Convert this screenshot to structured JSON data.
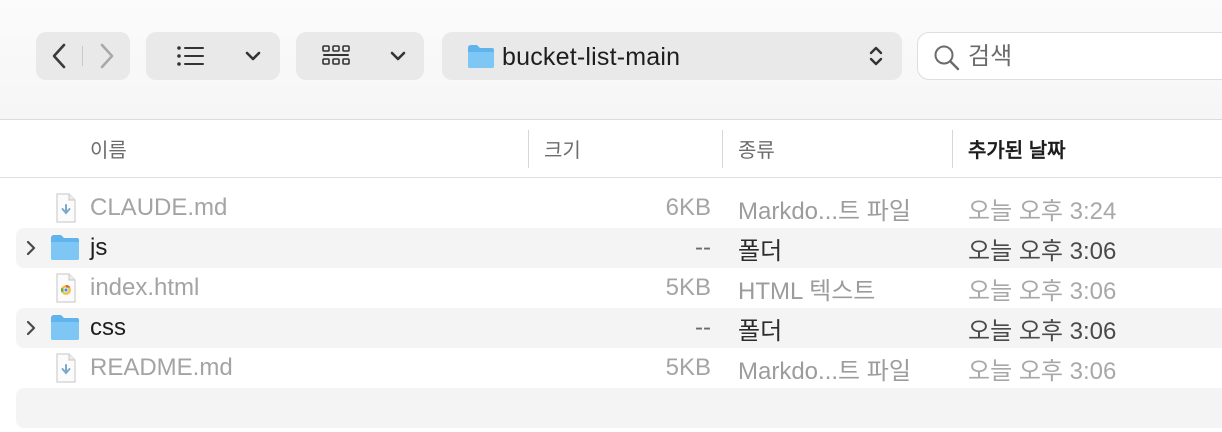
{
  "toolbar": {
    "back_icon": "chevron-left-icon",
    "forward_icon": "chevron-right-icon",
    "list_view_icon": "list-view-icon",
    "grid_view_icon": "icon-grid-icon",
    "path": {
      "folder_icon": "folder-icon",
      "label": "bucket-list-main"
    },
    "search": {
      "placeholder": "검색",
      "value": ""
    }
  },
  "columns": {
    "name": "이름",
    "size": "크기",
    "kind": "종류",
    "date_added": "추가된 날짜",
    "sorted_by": "date_added"
  },
  "rows": [
    {
      "name": "CLAUDE.md",
      "size": "6KB",
      "kind": "Markdo...트 파일",
      "date": "오늘 오후 3:24",
      "type": "markdown-file",
      "dimmed": true
    },
    {
      "name": "js",
      "size": "--",
      "kind": "폴더",
      "date": "오늘 오후 3:06",
      "type": "folder",
      "dimmed": false
    },
    {
      "name": "index.html",
      "size": "5KB",
      "kind": "HTML 텍스트",
      "date": "오늘 오후 3:06",
      "type": "html-file",
      "dimmed": true
    },
    {
      "name": "css",
      "size": "--",
      "kind": "폴더",
      "date": "오늘 오후 3:06",
      "type": "folder",
      "dimmed": false
    },
    {
      "name": "README.md",
      "size": "5KB",
      "kind": "Markdo...트 파일",
      "date": "오늘 오후 3:06",
      "type": "markdown-file",
      "dimmed": true
    }
  ],
  "colors": {
    "folder": "#5fb4ec",
    "row_stripe": "#f3f4f3",
    "toolbar_button": "#e9e9e9"
  }
}
